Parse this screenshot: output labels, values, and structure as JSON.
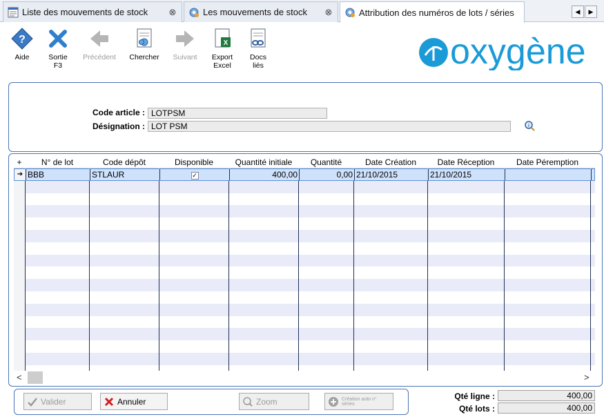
{
  "tabs": [
    {
      "label": "Liste des mouvements de stock",
      "close": "⊗"
    },
    {
      "label": "Les mouvements de stock",
      "close": "⊗"
    },
    {
      "label": "Attribution des numéros de lots / séries",
      "close": ""
    }
  ],
  "tab_nav": {
    "prev": "◀",
    "next": "▶"
  },
  "toolbar": {
    "aide": "Aide",
    "sortie": "Sortie",
    "sortie_key": "F3",
    "precedent": "Précédent",
    "chercher": "Chercher",
    "suivant": "Suivant",
    "export": "Export",
    "export2": "Excel",
    "docs": "Docs",
    "docs2": "liés"
  },
  "brand": {
    "name": "oxygène",
    "color": "#1a9bd7"
  },
  "form": {
    "code_article_label": "Code article :",
    "code_article_value": "LOTPSM",
    "designation_label": "Désignation :",
    "designation_value": "LOT PSM"
  },
  "grid": {
    "corner": "+",
    "columns": [
      "N° de lot",
      "Code dépôt",
      "Disponible",
      "Quantité initiale",
      "Quantité",
      "Date Création",
      "Date Réception",
      "Date Péremption"
    ],
    "rows": [
      {
        "indicator": "➔",
        "lot": "BBB",
        "depot": "STLAUR",
        "disponible": "✓",
        "qte_initiale": "400,00",
        "quantite": "0,00",
        "date_creation": "21/10/2015",
        "date_reception": "21/10/2015",
        "date_peremption": ""
      }
    ]
  },
  "scroll": {
    "left": "<",
    "right": ">"
  },
  "buttons": {
    "valider": "Valider",
    "annuler": "Annuler",
    "zoom": "Zoom",
    "creation": "Création auto n° séries"
  },
  "totals": {
    "qte_ligne_label": "Qté ligne :",
    "qte_ligne_value": "400,00",
    "qte_lots_label": "Qté lots :",
    "qte_lots_value": "400,00"
  },
  "colors": {
    "accent": "#4a74b5",
    "selection": "#cfe2fb",
    "alt_row": "#e9ecf8"
  }
}
